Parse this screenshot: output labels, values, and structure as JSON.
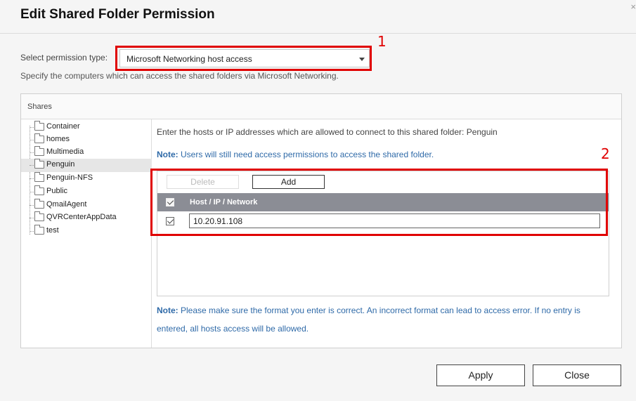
{
  "dialog": {
    "title": "Edit Shared Folder Permission",
    "close_glyph": "×"
  },
  "permission": {
    "label": "Select permission type:",
    "selected": "Microsoft Networking host access",
    "description": "Specify the computers which can access the shared folders via Microsoft Networking."
  },
  "annotations": {
    "box1_number": "1",
    "box2_number": "2",
    "color": "#e00000"
  },
  "shares": {
    "header": "Shares",
    "items": [
      {
        "label": "Container"
      },
      {
        "label": "homes"
      },
      {
        "label": "Multimedia"
      },
      {
        "label": "Penguin",
        "selected": true
      },
      {
        "label": "Penguin-NFS"
      },
      {
        "label": "Public"
      },
      {
        "label": "QmailAgent"
      },
      {
        "label": "QVRCenterAppData"
      },
      {
        "label": "test"
      }
    ]
  },
  "main": {
    "info": "Enter the hosts or IP addresses which are allowed to connect to this shared folder: Penguin",
    "note_label": "Note:",
    "note_text": " Users will still need access permissions to access the shared folder.",
    "toolbar": {
      "delete_label": "Delete",
      "add_label": "Add"
    },
    "table": {
      "column": "Host / IP / Network",
      "rows": [
        {
          "checked": true,
          "value": "10.20.91.108"
        }
      ]
    },
    "bottom_note_label": "Note:",
    "bottom_note_text": " Please make sure the format you enter is correct. An incorrect format can lead to access error. If no entry is entered, all hosts access will be allowed."
  },
  "footer": {
    "apply_label": "Apply",
    "close_label": "Close"
  },
  "colors": {
    "link_blue": "#2f6aa8",
    "table_header": "#8b8d95",
    "selected_row": "#e6e6e6"
  }
}
